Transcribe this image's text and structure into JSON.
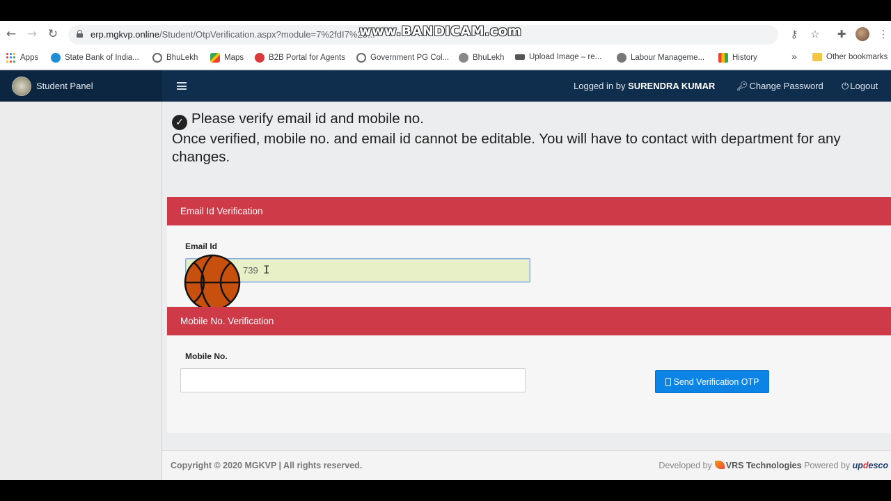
{
  "browser": {
    "url_host": "erp.mgkvp.online",
    "url_path": "/Student/OtpVerification.aspx?module=7%2fdI7%2b...",
    "watermark": "www.BANDICAM.com",
    "bookmarks": [
      {
        "label": "Apps",
        "icon": "apps-grid-icon"
      },
      {
        "label": "State Bank of India...",
        "icon": "sbi-icon"
      },
      {
        "label": "BhuLekh",
        "icon": "globe-icon"
      },
      {
        "label": "Maps",
        "icon": "maps-icon"
      },
      {
        "label": "B2B Portal for Agents",
        "icon": "b2b-icon"
      },
      {
        "label": "Government PG Col...",
        "icon": "globe-icon"
      },
      {
        "label": "BhuLekh",
        "icon": "emblem-icon"
      },
      {
        "label": "Upload Image – re...",
        "icon": "upload-icon"
      },
      {
        "label": "Labour Manageme...",
        "icon": "emblem-icon"
      },
      {
        "label": "History",
        "icon": "history-icon"
      }
    ],
    "more_bookmarks": "»",
    "other_bookmarks": "Other bookmarks"
  },
  "header": {
    "brand": "Student Panel",
    "logged_in_prefix": "Logged in by ",
    "user_name": "SURENDRA KUMAR",
    "change_password": "Change Password",
    "logout": "Logout"
  },
  "notice": {
    "line1": "Please verify email id and mobile no.",
    "line2": "Once verified, mobile no. and email id cannot be editable. You will have to contact with department for any changes."
  },
  "email_section": {
    "title": "Email Id Verification",
    "label": "Email Id",
    "value": "739"
  },
  "mobile_section": {
    "title": "Mobile No. Verification",
    "label": "Mobile No.",
    "value": "",
    "button": "Send Verification OTP"
  },
  "footer": {
    "copyright": "Copyright © 2020 MGKVP | All rights reserved.",
    "developed_by": "Developed by",
    "developer": "VRS Technologies",
    "powered_by": "Powered by",
    "powered_name_a": "up",
    "powered_name_o": "d",
    "powered_name_b": "esco"
  },
  "colors": {
    "header_bg": "#0f2d4d",
    "section_red": "#ce3a48",
    "button_blue": "#0b84e6"
  }
}
